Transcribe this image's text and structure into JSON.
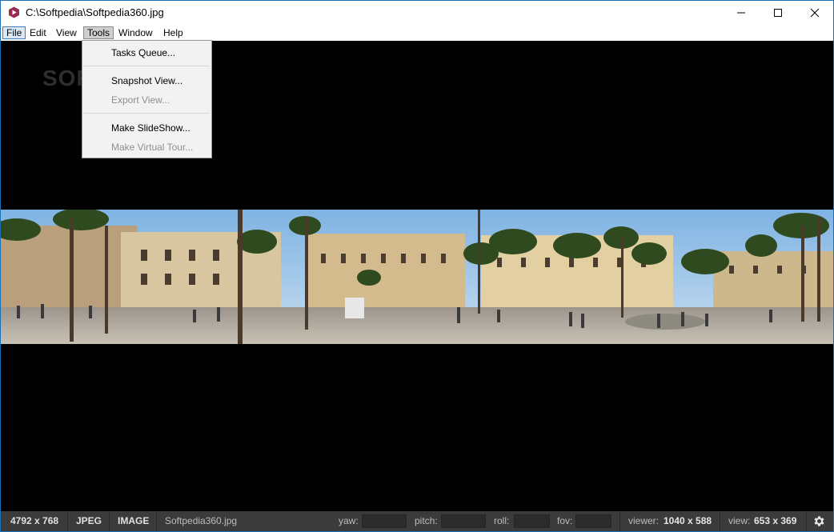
{
  "titlebar": {
    "title": "C:\\Softpedia\\Softpedia360.jpg"
  },
  "menu": {
    "items": [
      "File",
      "Edit",
      "View",
      "Tools",
      "Window",
      "Help"
    ]
  },
  "tools_menu": {
    "items": [
      {
        "label": "Tasks Queue...",
        "enabled": true
      },
      {
        "label": "Snapshot View...",
        "enabled": true
      },
      {
        "label": "Export View...",
        "enabled": false
      },
      {
        "label": "Make SlideShow...",
        "enabled": true
      },
      {
        "label": "Make Virtual Tour...",
        "enabled": false
      }
    ]
  },
  "watermark": "SOFTPEDIA",
  "statusbar": {
    "dimensions": "4792 x 768",
    "format": "JPEG",
    "type": "IMAGE",
    "filename": "Softpedia360.jpg",
    "yaw_label": "yaw:",
    "yaw_value": "",
    "pitch_label": "pitch:",
    "pitch_value": "",
    "roll_label": "roll:",
    "roll_value": "",
    "fov_label": "fov:",
    "fov_value": "",
    "viewer_label": "viewer:",
    "viewer_value": "1040 x 588",
    "view_label": "view:",
    "view_value": "653 x 369"
  },
  "colors": {
    "accent": "#3c7fc4",
    "app_icon": "#9b2a55",
    "statusbar_bg": "#3b3b3b"
  },
  "icons": {
    "app": "app-logo-icon",
    "minimize": "minimize-icon",
    "maximize": "maximize-icon",
    "close": "close-icon",
    "settings": "gear-icon"
  }
}
